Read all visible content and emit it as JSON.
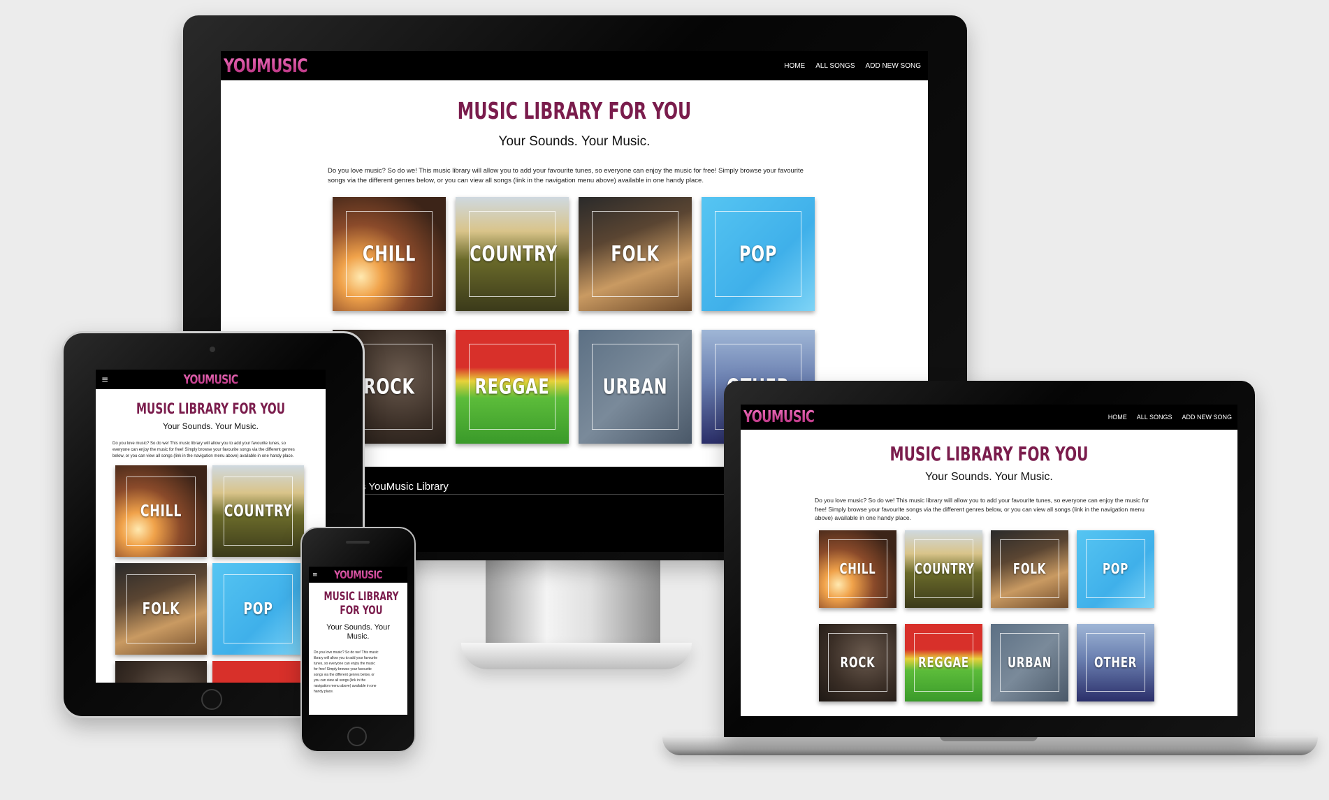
{
  "site": {
    "logo": "YOUMUSIC",
    "nav": [
      "HOME",
      "ALL SONGS",
      "ADD NEW SONG"
    ],
    "menu_icon": "hamburger-icon",
    "heading": "MUSIC LIBRARY FOR YOU",
    "tagline": "Your Sounds. Your Music.",
    "intro_desktop_line1": "Do you love music? So do we! This music library will allow you to add your favourite tunes, so everyone can enjoy the music for free! Simply browse your favourite",
    "intro_desktop_line2": "songs via the different genres below, or you can view all songs (link in the navigation menu above) available in one handy place.",
    "intro_laptop_line1": "Do you love music? So do we! This music library will allow you to add your favourite tunes, so everyone can enjoy the music for",
    "intro_laptop_line2": "free! Simply browse your favourite songs via the different genres below, or you can view all songs (link in the navigation menu",
    "intro_laptop_line3": "above) available in one handy place.",
    "intro_tablet_line1": "Do you love music? So do we! This music library will allow you to add your favourite tunes, so",
    "intro_tablet_line2": "everyone can enjoy the music for free! Simply browse your favourite songs via the different genres",
    "intro_tablet_line3": "below, or you can view all songs (link in the navigation menu above) available in one handy place.",
    "intro_phone_line1": "Do you love music? So do we! This music",
    "intro_phone_line2": "library will allow you to add your favourite",
    "intro_phone_line3": "tunes, so everyone can enjoy the music",
    "intro_phone_line4": "for free! Simply browse your favourite",
    "intro_phone_line5": "songs via the different genres below, or",
    "intro_phone_line6": "you can view all songs (link in the",
    "intro_phone_line7": "navigation menu above) available in one",
    "intro_phone_line8": "handy place.",
    "footer_partial": "s YouMusic Library",
    "genres": [
      "CHILL",
      "COUNTRY",
      "FOLK",
      "POP",
      "ROCK",
      "REGGAE",
      "URBAN",
      "OTHER"
    ],
    "tablet_genres": [
      "CHILL",
      "COUNTRY",
      "FOLK",
      "POP"
    ]
  },
  "colors": {
    "heading": "#7a1c4c",
    "logo_top": "#f06fbd",
    "logo_bottom": "#b02a78",
    "nav_bg": "#000000",
    "page_bg": "#ececec"
  }
}
